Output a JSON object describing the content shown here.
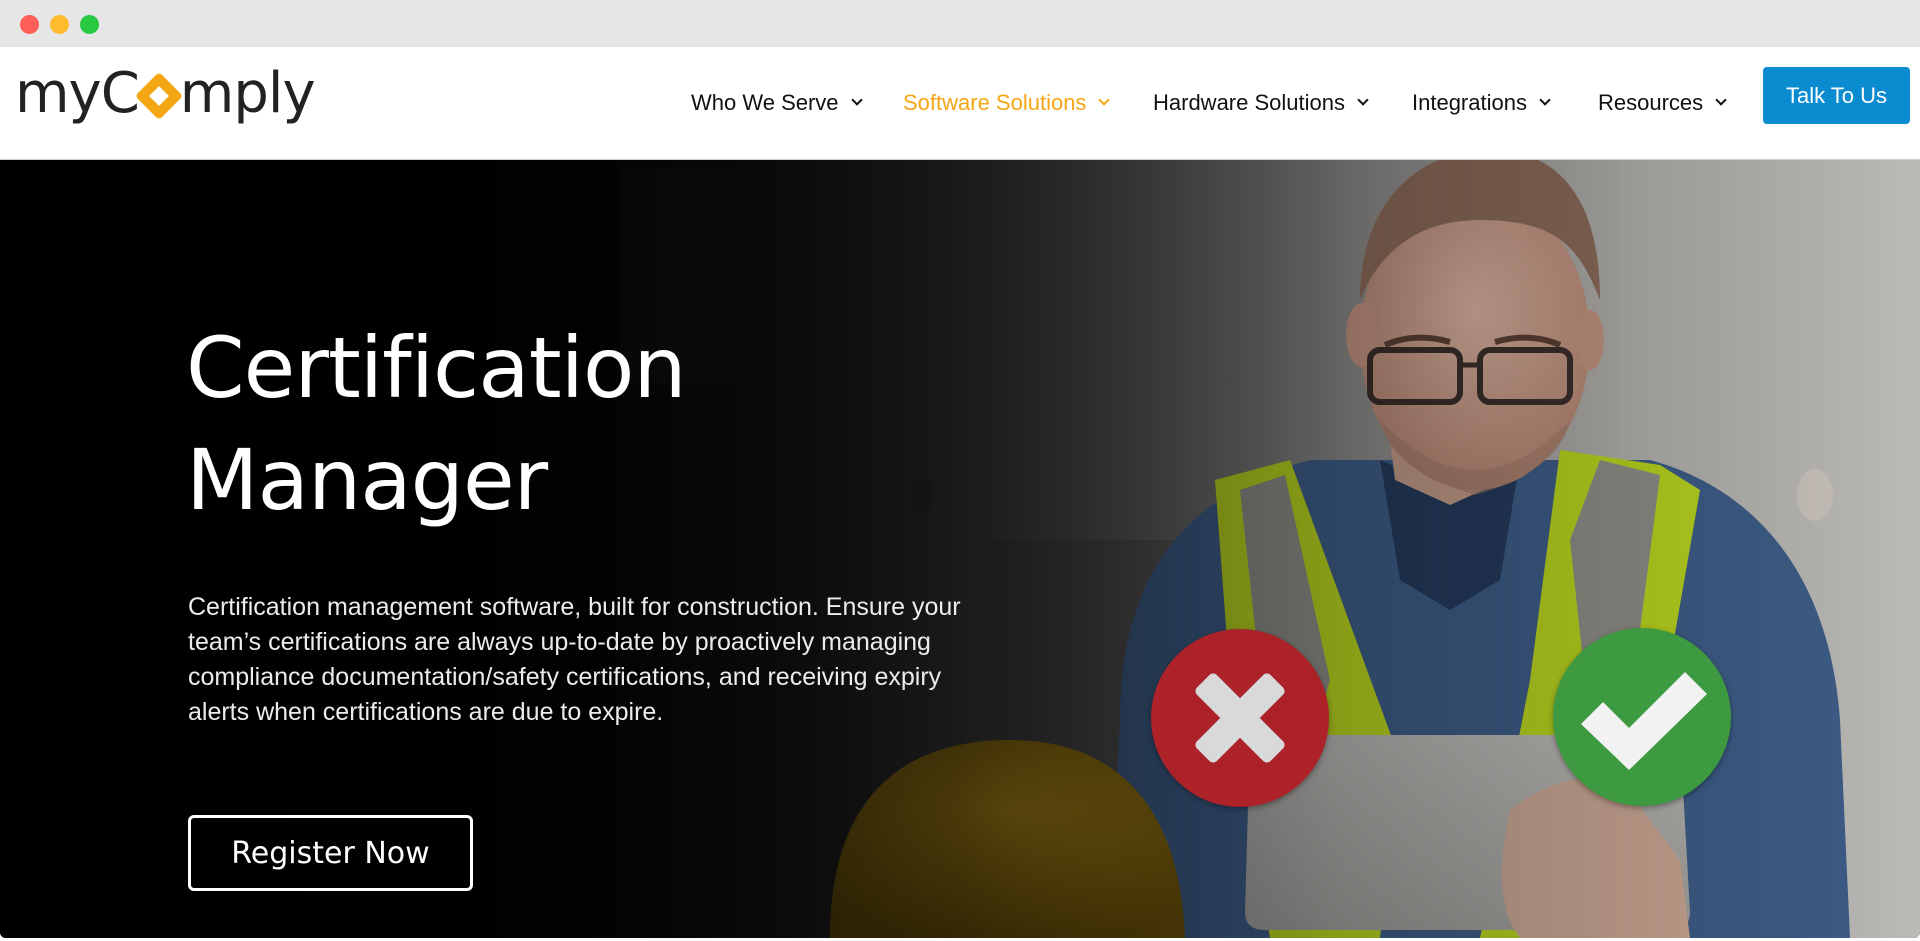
{
  "browser": {
    "window_controls": [
      "close",
      "minimize",
      "maximize"
    ]
  },
  "header": {
    "logo": {
      "prefix": "myC",
      "suffix": "mply",
      "icon": "diamond-o-icon",
      "accent_color": "#f5a614"
    },
    "nav": [
      {
        "label": "Who We Serve",
        "active": false,
        "icon": "chevron-down-icon"
      },
      {
        "label": "Software Solutions",
        "active": true,
        "icon": "chevron-down-icon"
      },
      {
        "label": "Hardware Solutions",
        "active": false,
        "icon": "chevron-down-icon"
      },
      {
        "label": "Integrations",
        "active": false,
        "icon": "chevron-down-icon"
      },
      {
        "label": "Resources",
        "active": false,
        "icon": "chevron-down-icon"
      }
    ],
    "cta_label": "Talk To Us",
    "cta_color": "#0b8bd0",
    "active_color": "#f5a614"
  },
  "hero": {
    "title_line1": "Certification",
    "title_line2": "Manager",
    "description": "Certification management software, built for construction. Ensure your team’s certifications are always up-to-date by proactively managing compliance documentation/safety certifications, and receiving expiry alerts when certifications are due to expire.",
    "register_label": "Register Now",
    "image": {
      "subject": "construction worker in hi-vis vest and glasses looking at a tablet",
      "badges": [
        {
          "icon": "x-mark-icon",
          "color": "#ac2228"
        },
        {
          "icon": "checkmark-icon",
          "color": "#3e9a40"
        }
      ]
    }
  }
}
